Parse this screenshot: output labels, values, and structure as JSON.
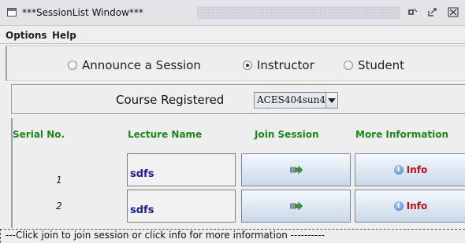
{
  "window": {
    "title": "***SessionList Window***",
    "icons": {
      "app": "window-icon",
      "minimize": "minimize-icon",
      "maximize": "maximize-icon",
      "close": "close-icon"
    }
  },
  "menubar": {
    "items": [
      "Options",
      "Help"
    ]
  },
  "roles": {
    "options": [
      {
        "label": "Announce a Session",
        "checked": false
      },
      {
        "label": "Instructor",
        "checked": true
      },
      {
        "label": "Student",
        "checked": false
      }
    ]
  },
  "course": {
    "label": "Course Registered",
    "selected": "ACES404sun4"
  },
  "table": {
    "headers": [
      "Serial No.",
      "Lecture Name",
      "Join Session",
      "More Information"
    ],
    "rows": [
      {
        "serial": "1",
        "lecture": "sdfs",
        "join_icon": "join-arrow-icon",
        "info_label": "Info"
      },
      {
        "serial": "2",
        "lecture": "sdfs",
        "join_icon": "join-arrow-icon",
        "info_label": "Info"
      }
    ]
  },
  "status": {
    "text": "---Click join to join session or click info for more information ----------"
  },
  "colors": {
    "header_green": "#1a8a1a",
    "lecture_blue": "#1c1c9c",
    "info_red": "#c0101a"
  }
}
